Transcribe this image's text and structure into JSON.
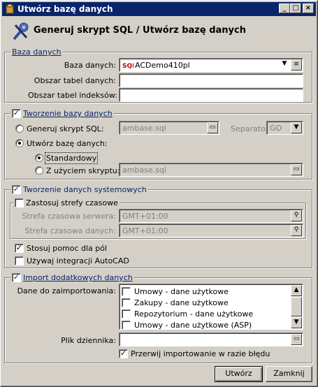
{
  "window": {
    "title": "Utwórz bazę danych",
    "header": "Generuj skrypt SQL / Utwórz bazę danych"
  },
  "baza": {
    "legend": "Baza danych",
    "db_label": "Baza danych:",
    "db_value": "ACDemo410pl",
    "tables_label": "Obszar tabel danych:",
    "tables_value": "",
    "index_label": "Obszar tabel indeksów:",
    "index_value": ""
  },
  "tworzenie": {
    "legend": "Tworzenie bazy danych",
    "gen_label": "Generuj skrypt SQL:",
    "gen_value": "ambase.sql",
    "sep_label": "Separator:",
    "sep_value": "GO",
    "create_label": "Utwórz bazę danych:",
    "std_label": "Standardowy",
    "script_label": "Z użyciem skryptu:",
    "script_value": "ambase.sql"
  },
  "system": {
    "legend": "Tworzenie danych systemowych",
    "tz_legend": "Zastosuj strefy czasowe",
    "server_tz_label": "Strefa czasowa serwera:",
    "server_tz_value": "GMT+01:00",
    "data_tz_label": "Strefa czasowa danych:",
    "data_tz_value": "GMT+01:00",
    "help_label": "Stosuj pomoc dla pól",
    "autocad_label": "Używaj integracji AutoCAD"
  },
  "import": {
    "legend": "Import dodatkowych danych",
    "data_label": "Dane do zaimportowania:",
    "items": [
      "Umowy - dane użytkowe",
      "Zakupy - dane użytkowe",
      "Repozytorium - dane użytkowe",
      "Umowy - dane użytkowe (ASP)"
    ],
    "log_label": "Plik dziennika:",
    "log_value": "",
    "abort_label": "Przerwij importowanie w razie błędu"
  },
  "buttons": {
    "create": "Utwórz",
    "close": "Zamknij"
  },
  "icons": {
    "title": "database-icon",
    "header": "tools-icon",
    "db": "sql-icon",
    "browse": "folder-icon",
    "search": "search-icon"
  }
}
